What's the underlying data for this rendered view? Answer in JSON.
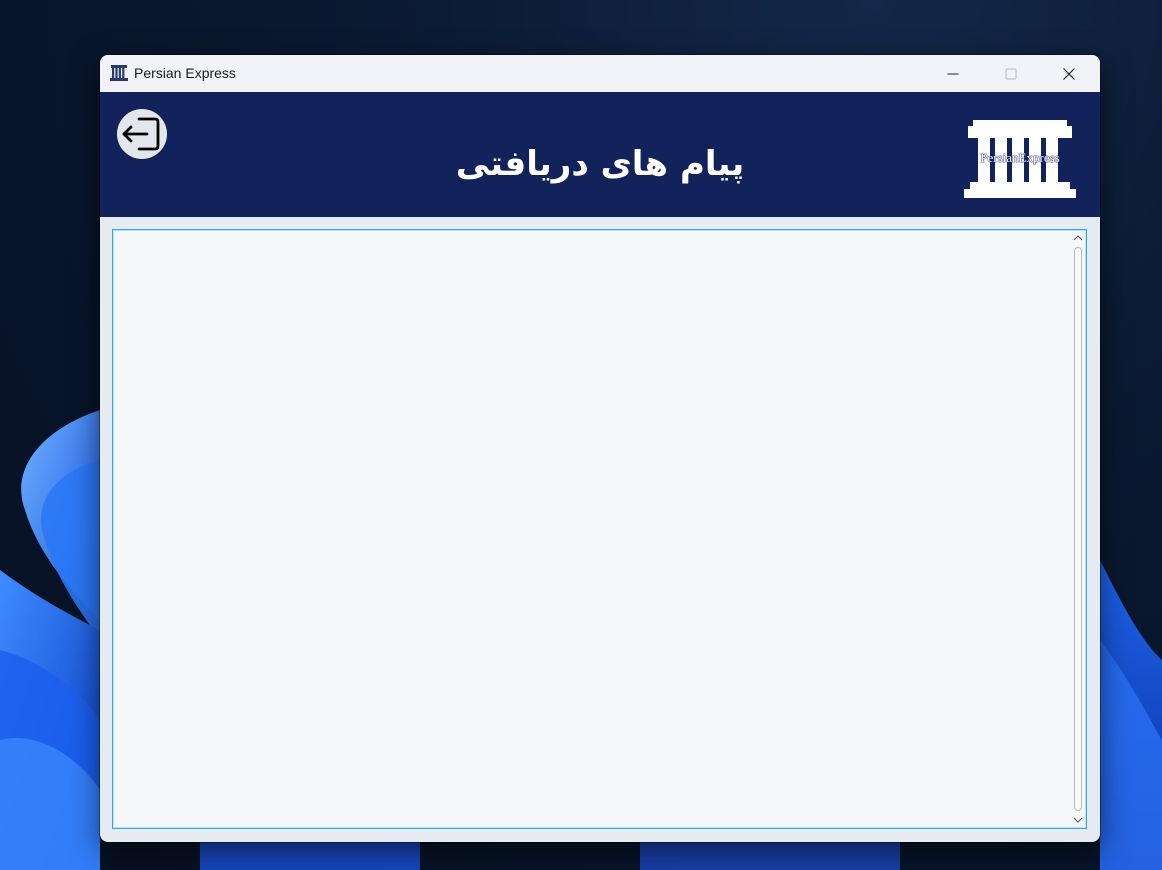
{
  "window": {
    "title": "Persian Express",
    "app_icon": "building-columns-icon",
    "controls": {
      "minimize_icon": "minimize-icon",
      "maximize_icon": "maximize-icon",
      "close_icon": "close-icon"
    }
  },
  "header": {
    "title": "پیام های دریافتی",
    "back_icon": "sign-out-arrow-icon",
    "logo_text": "PersianExpress",
    "logo_icon": "building-columns-icon",
    "background_color": "#12235c"
  },
  "message_area": {
    "border_color": "#2fa8e0",
    "scrollbar": {
      "up_icon": "chevron-up-icon",
      "down_icon": "chevron-down-icon"
    }
  }
}
